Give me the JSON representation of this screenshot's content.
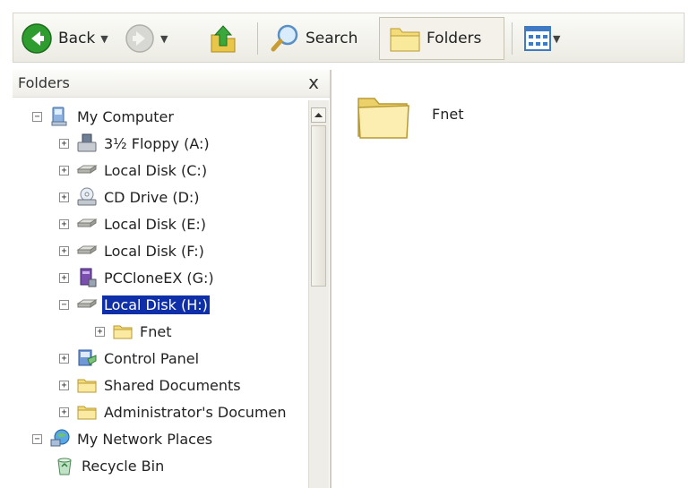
{
  "toolbar": {
    "back_label": "Back",
    "search_label": "Search",
    "folders_label": "Folders"
  },
  "folders_pane": {
    "title": "Folders",
    "close_glyph": "x"
  },
  "tree": {
    "my_computer": "My Computer",
    "floppy": "3½ Floppy (A:)",
    "disk_c": "Local Disk (C:)",
    "cd_drive": "CD Drive (D:)",
    "disk_e": "Local Disk (E:)",
    "disk_f": "Local Disk (F:)",
    "pcclone": "PCCloneEX (G:)",
    "disk_h": "Local Disk (H:)",
    "fnet": "Fnet",
    "control_panel": "Control Panel",
    "shared_docs": "Shared Documents",
    "admin_docs": "Administrator's Documen",
    "network": "My Network Places",
    "recycle": "Recycle Bin"
  },
  "content": {
    "items": [
      {
        "label": "Fnet",
        "icon": "folder-icon"
      }
    ]
  },
  "colors": {
    "selection": "#0f2fa8",
    "folder_yellow": "#f4dc7a",
    "back_green": "#2f9c2f"
  }
}
